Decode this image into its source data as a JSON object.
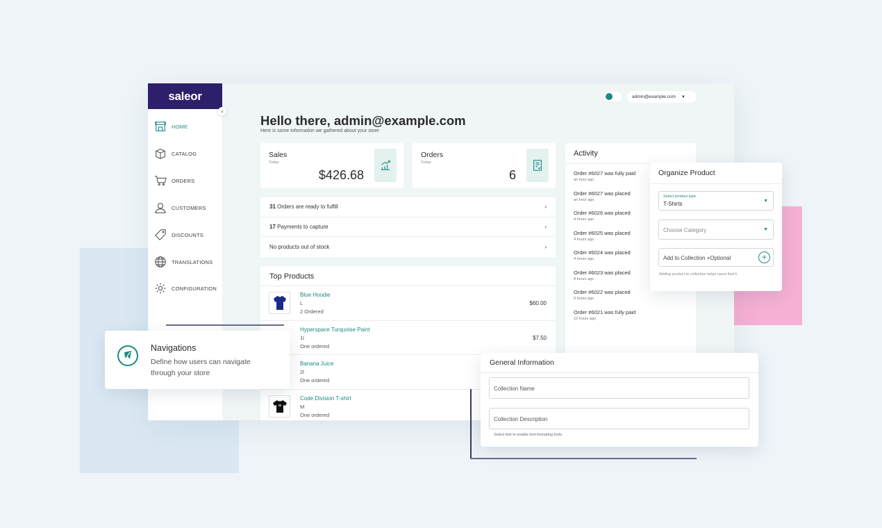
{
  "sidebar": {
    "logo": "saleor",
    "items": [
      {
        "label": "HOME",
        "icon": "store-icon",
        "active": true
      },
      {
        "label": "CATALOG",
        "icon": "box-icon"
      },
      {
        "label": "ORDERS",
        "icon": "cart-icon"
      },
      {
        "label": "CUSTOMERS",
        "icon": "user-icon"
      },
      {
        "label": "DISCOUNTS",
        "icon": "tag-icon"
      },
      {
        "label": "TRANSLATIONS",
        "icon": "globe-icon"
      },
      {
        "label": "CONFIGURATION",
        "icon": "gear-icon"
      }
    ]
  },
  "topbar": {
    "user_email": "admin@example.com"
  },
  "header": {
    "title": "Hello there, admin@example.com",
    "subtitle": "Here is some information we gathered about your store"
  },
  "stats": {
    "sales": {
      "title": "Sales",
      "period": "Today",
      "value": "$426.68"
    },
    "orders": {
      "title": "Orders",
      "period": "Today",
      "value": "6"
    }
  },
  "notifications": [
    {
      "count": "31",
      "text": " Orders are ready to fulfill"
    },
    {
      "count": "17",
      "text": " Payments to capture"
    },
    {
      "count": "",
      "text": "No products out of stock"
    }
  ],
  "top_products": {
    "title": "Top Products",
    "items": [
      {
        "name": "Blue Hoodie",
        "variant": "L",
        "ordered": "2 Ordered",
        "price": "$60.00"
      },
      {
        "name": "Hyperspace Turquoise Paint",
        "variant": "1l",
        "ordered": "One ordered",
        "price": "$7.50"
      },
      {
        "name": "Banana Juice",
        "variant": "2l",
        "ordered": "One ordered",
        "price": ""
      },
      {
        "name": "Code Division T-shirt",
        "variant": "M",
        "ordered": "One ordered",
        "price": ""
      }
    ]
  },
  "activity": {
    "title": "Activity",
    "items": [
      {
        "text": "Order #6027 was fully paid",
        "time": "an hour ago"
      },
      {
        "text": "Order #6027 was placed",
        "time": "an hour ago"
      },
      {
        "text": "Order #6026 was placed",
        "time": "4 hours ago"
      },
      {
        "text": "Order #6025 was placed",
        "time": "4 hours ago"
      },
      {
        "text": "Order #6024 was placed",
        "time": "4 hours ago"
      },
      {
        "text": "Order #6023 was placed",
        "time": "8 hours ago"
      },
      {
        "text": "Order #6022 was placed",
        "time": "9 hours ago"
      },
      {
        "text": "Order #6021 was fully paid",
        "time": "12 hours ago"
      }
    ]
  },
  "organize_product": {
    "title": "Organize Product",
    "product_type_label": "Select product type",
    "product_type_value": "T-Shirts",
    "category_placeholder": "Choose Category",
    "collection_placeholder": "Add to Collection +Optional",
    "collection_help": "Adding product to collection helps users find it."
  },
  "general_info": {
    "title": "General Information",
    "name_placeholder": "Collection Name",
    "description_placeholder": "Collection Description",
    "help": "Select text to enable text-formating tools."
  },
  "navigations_tooltip": {
    "title": "Navigations",
    "description": "Define how users can navigate through your store"
  },
  "colors": {
    "accent": "#1c8a80",
    "brand": "#2e1f6b",
    "pink": "#f5b0d3"
  }
}
